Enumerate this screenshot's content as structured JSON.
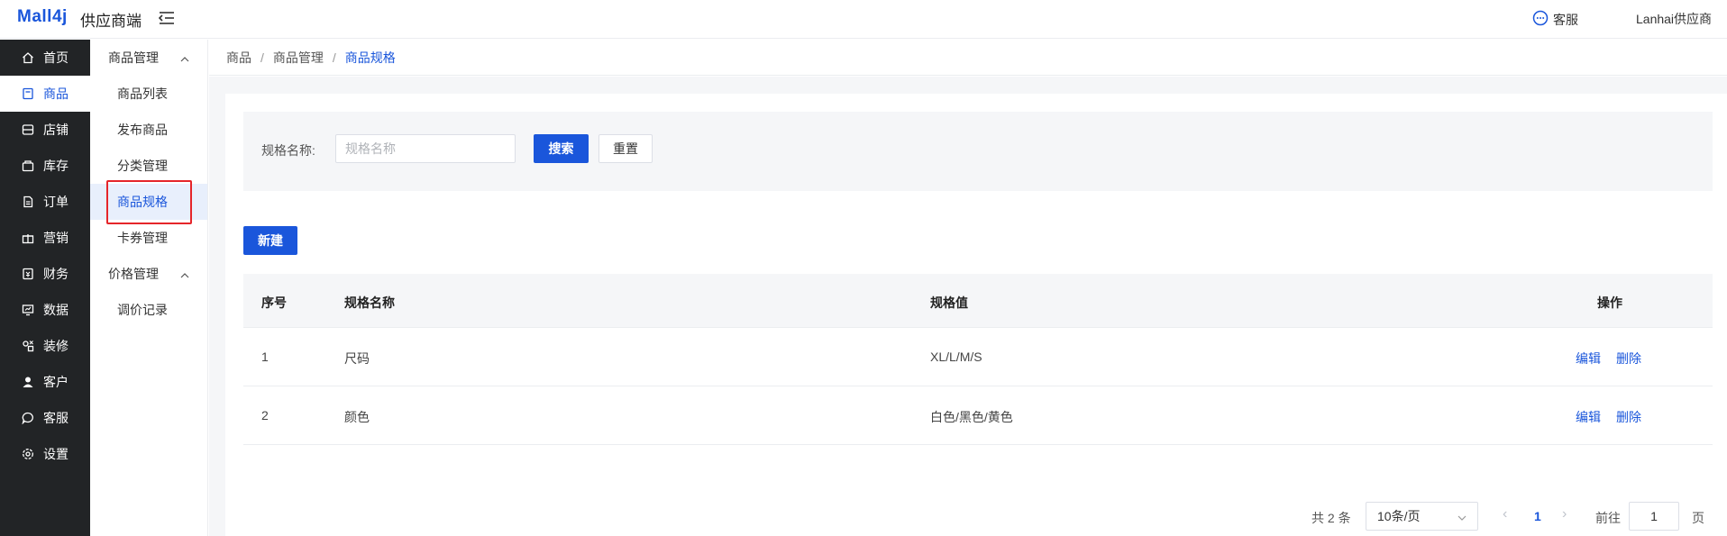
{
  "header": {
    "logo": "Mall4j",
    "subtitle": "供应商端",
    "service_label": "客服",
    "user_name": "Lanhai供应商"
  },
  "sidebar": {
    "items": [
      {
        "label": "首页",
        "icon": "home-icon"
      },
      {
        "label": "商品",
        "icon": "goods-icon"
      },
      {
        "label": "店铺",
        "icon": "shop-icon"
      },
      {
        "label": "库存",
        "icon": "stock-icon"
      },
      {
        "label": "订单",
        "icon": "order-icon"
      },
      {
        "label": "营销",
        "icon": "gift-icon"
      },
      {
        "label": "财务",
        "icon": "finance-icon"
      },
      {
        "label": "数据",
        "icon": "data-icon"
      },
      {
        "label": "装修",
        "icon": "decorate-icon"
      },
      {
        "label": "客户",
        "icon": "user-icon"
      },
      {
        "label": "客服",
        "icon": "chat-icon"
      },
      {
        "label": "设置",
        "icon": "settings-icon"
      }
    ],
    "active_index": 1
  },
  "subnav": {
    "group1": "商品管理",
    "group1_items": [
      "商品列表",
      "发布商品",
      "分类管理",
      "商品规格",
      "卡券管理"
    ],
    "group2": "价格管理",
    "group2_items": [
      "调价记录"
    ],
    "active_item": "商品规格"
  },
  "breadcrumb": [
    "商品",
    "商品管理",
    "商品规格"
  ],
  "search": {
    "label": "规格名称:",
    "placeholder": "规格名称",
    "value": "",
    "search_button": "搜索",
    "reset_button": "重置"
  },
  "toolbar": {
    "new_button": "新建"
  },
  "table": {
    "columns": [
      "序号",
      "规格名称",
      "规格值",
      "操作"
    ],
    "rows": [
      {
        "index": "1",
        "name": "尺码",
        "values": "XL/L/M/S",
        "edit": "编辑",
        "delete": "删除"
      },
      {
        "index": "2",
        "name": "颜色",
        "values": "白色/黑色/黄色",
        "edit": "编辑",
        "delete": "删除"
      }
    ]
  },
  "pagination": {
    "total": "共 2 条",
    "page_size": "10条/页",
    "current_page": "1",
    "goto_label": "前往",
    "goto_value": "1",
    "page_suffix": "页"
  },
  "colors": {
    "primary": "#1a56db",
    "sidebar_bg": "#222426",
    "highlight_box": "#e5252a"
  }
}
